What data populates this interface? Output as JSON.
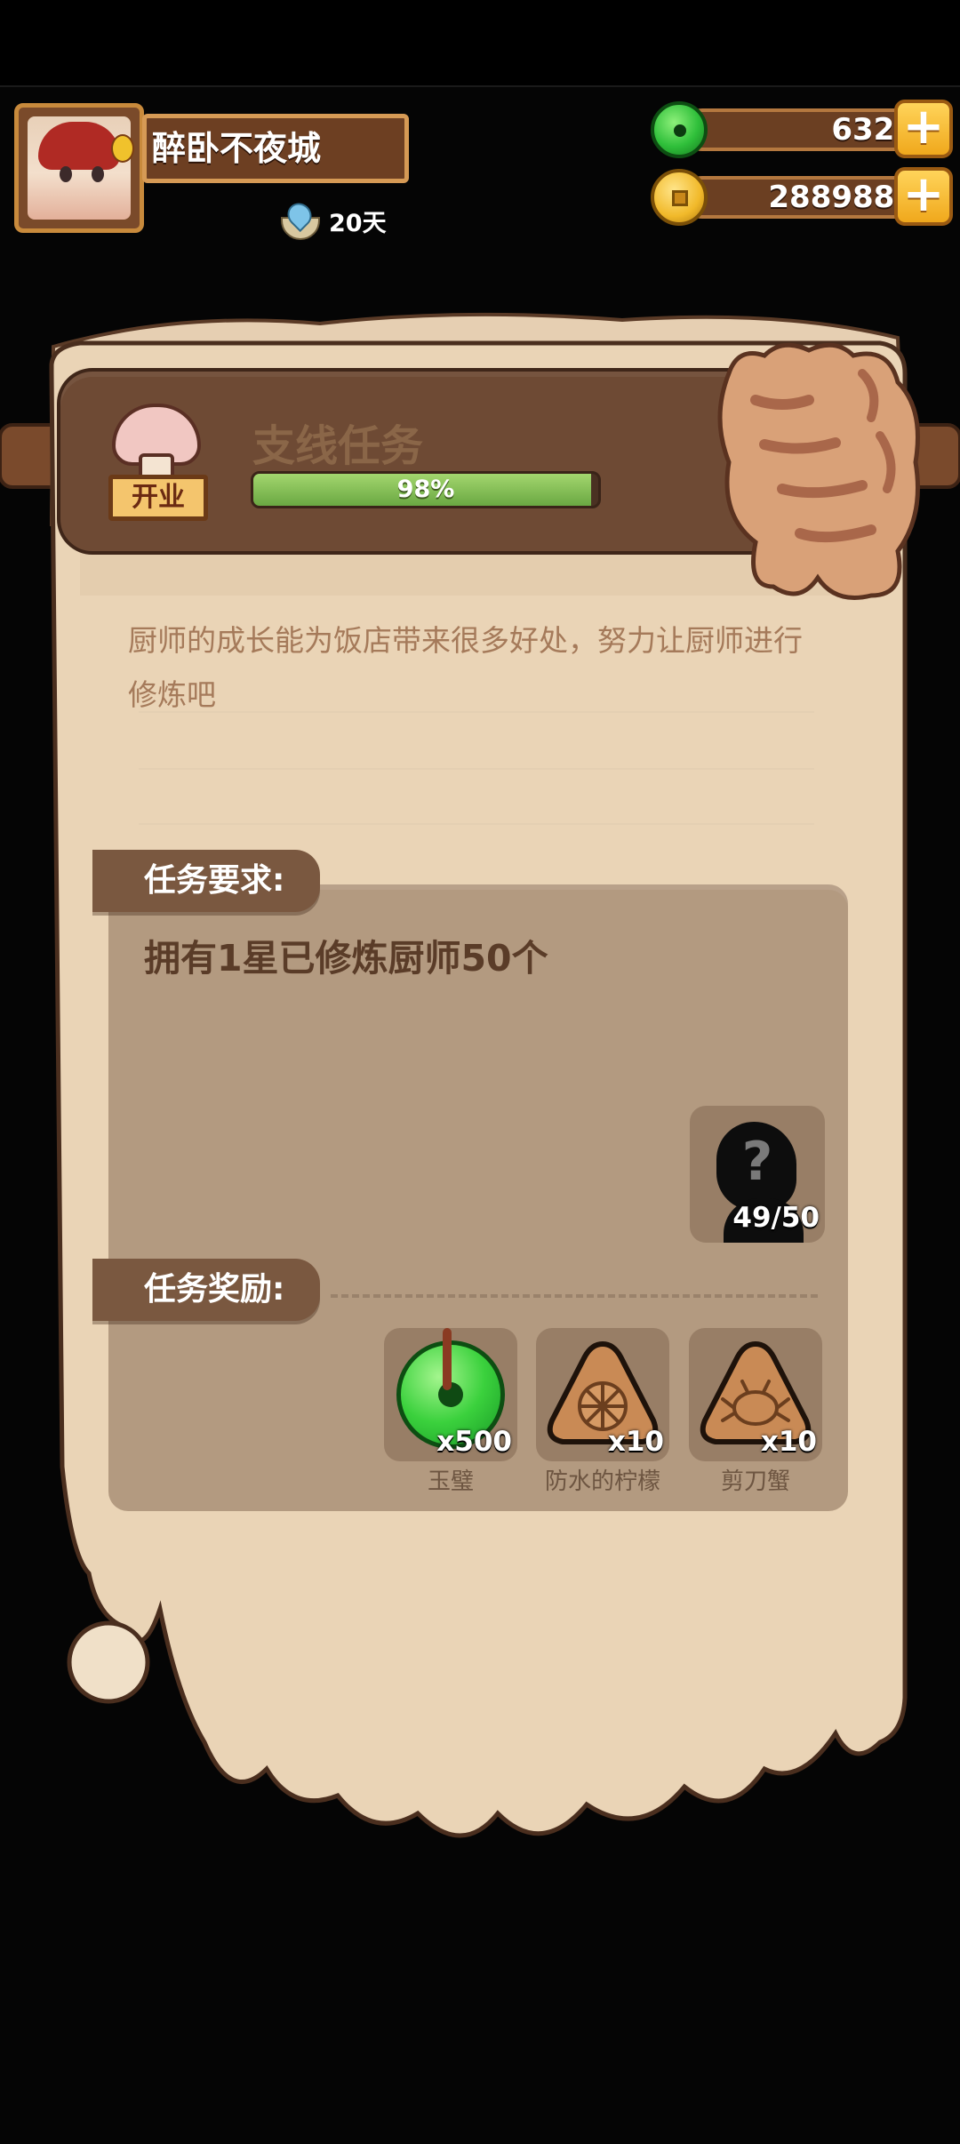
{
  "player": {
    "name": "醉卧不夜城",
    "days": "20天"
  },
  "resources": {
    "jade": "6326",
    "coins": "2889888",
    "add_symbol": "+"
  },
  "task": {
    "sign": "开业",
    "title": "支线任务",
    "progress_text": "98%",
    "progress_fraction": 0.98,
    "description": "厨师的成长能为饭店带来很多好处，努力让厨师进行修炼吧",
    "requirement_label": "任务要求:",
    "requirement_text": "拥有1星已修炼厨师50个",
    "requirement_progress": "49/50",
    "unknown_symbol": "?",
    "reward_label": "任务奖励:",
    "rewards": [
      {
        "icon": "jade-icon",
        "qty": "x500",
        "name": "玉璧"
      },
      {
        "icon": "lemon-icon",
        "qty": "x10",
        "name": "防水的柠檬"
      },
      {
        "icon": "crab-icon",
        "qty": "x10",
        "name": "剪刀蟹"
      }
    ]
  },
  "colors": {
    "parchment": "#e9d3b5",
    "board": "#6e4a34",
    "progress": "#7dbb4f",
    "panel": "#b39a80"
  }
}
